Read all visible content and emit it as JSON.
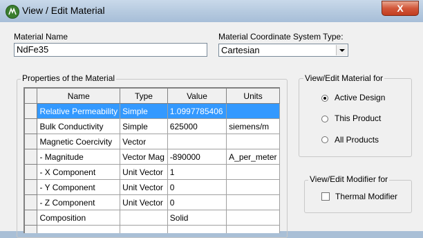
{
  "window": {
    "title": "View / Edit Material",
    "close_label": "X"
  },
  "material_name": {
    "label": "Material Name",
    "value": "NdFe35"
  },
  "coord_system": {
    "label": "Material Coordinate System Type:",
    "value": "Cartesian"
  },
  "properties": {
    "group_label": "Properties of the Material",
    "columns": [
      "Name",
      "Type",
      "Value",
      "Units"
    ],
    "rows": [
      {
        "name": "Relative Permeability",
        "type": "Simple",
        "value": "1.0997785406",
        "units": ""
      },
      {
        "name": "Bulk Conductivity",
        "type": "Simple",
        "value": "625000",
        "units": "siemens/m"
      },
      {
        "name": "Magnetic Coercivity",
        "type": "Vector",
        "value": "",
        "units": ""
      },
      {
        "name": "- Magnitude",
        "type": "Vector Mag",
        "value": "-890000",
        "units": "A_per_meter"
      },
      {
        "name": "- X Component",
        "type": "Unit Vector",
        "value": "1",
        "units": ""
      },
      {
        "name": "- Y Component",
        "type": "Unit Vector",
        "value": "0",
        "units": ""
      },
      {
        "name": "- Z Component",
        "type": "Unit Vector",
        "value": "0",
        "units": ""
      },
      {
        "name": "Composition",
        "type": "",
        "value": "Solid",
        "units": ""
      }
    ]
  },
  "view_edit_for": {
    "group_label": "View/Edit Material for",
    "options": [
      {
        "label": "Active Design",
        "selected": true
      },
      {
        "label": "This Product",
        "selected": false
      },
      {
        "label": "All Products",
        "selected": false
      }
    ]
  },
  "modifier_for": {
    "group_label": "View/Edit Modifier for",
    "thermal_label": "Thermal Modifier",
    "thermal_checked": false
  }
}
